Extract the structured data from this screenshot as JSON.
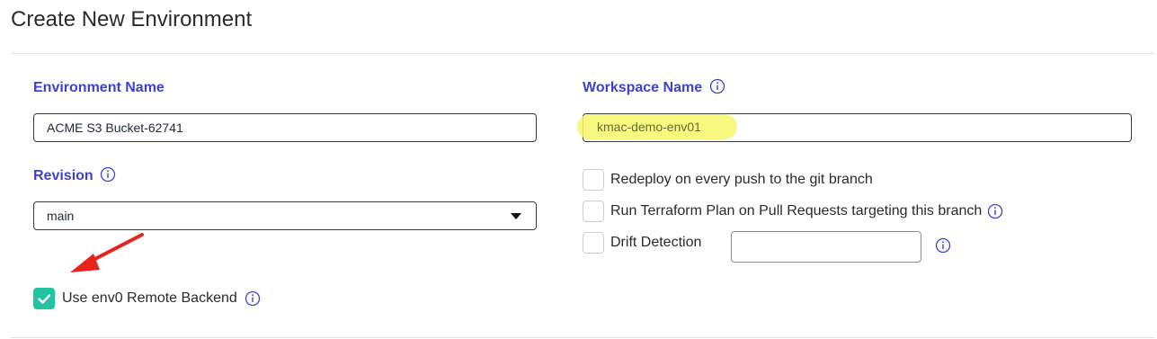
{
  "page": {
    "title": "Create New Environment"
  },
  "environment_name": {
    "label": "Environment Name",
    "value": "ACME S3 Bucket-62741"
  },
  "workspace_name": {
    "label": "Workspace Name",
    "value": "kmac-demo-env01"
  },
  "revision": {
    "label": "Revision",
    "selected": "main"
  },
  "options": {
    "redeploy_label": "Redeploy on every push to the git branch",
    "run_plan_label": "Run Terraform Plan on Pull Requests targeting this branch",
    "drift_label": "Drift Detection",
    "drift_value": ""
  },
  "remote_backend": {
    "label": "Use env0 Remote Backend",
    "checked": true
  },
  "colors": {
    "accent_label": "#3f3fd0",
    "checkbox_checked": "#22c3a0",
    "highlight": "#f4f76a",
    "annotation_arrow": "#e8231e"
  },
  "icons": [
    "info-icon",
    "checkmark-icon",
    "chevron-down-icon",
    "arrow-annotation-icon"
  ]
}
